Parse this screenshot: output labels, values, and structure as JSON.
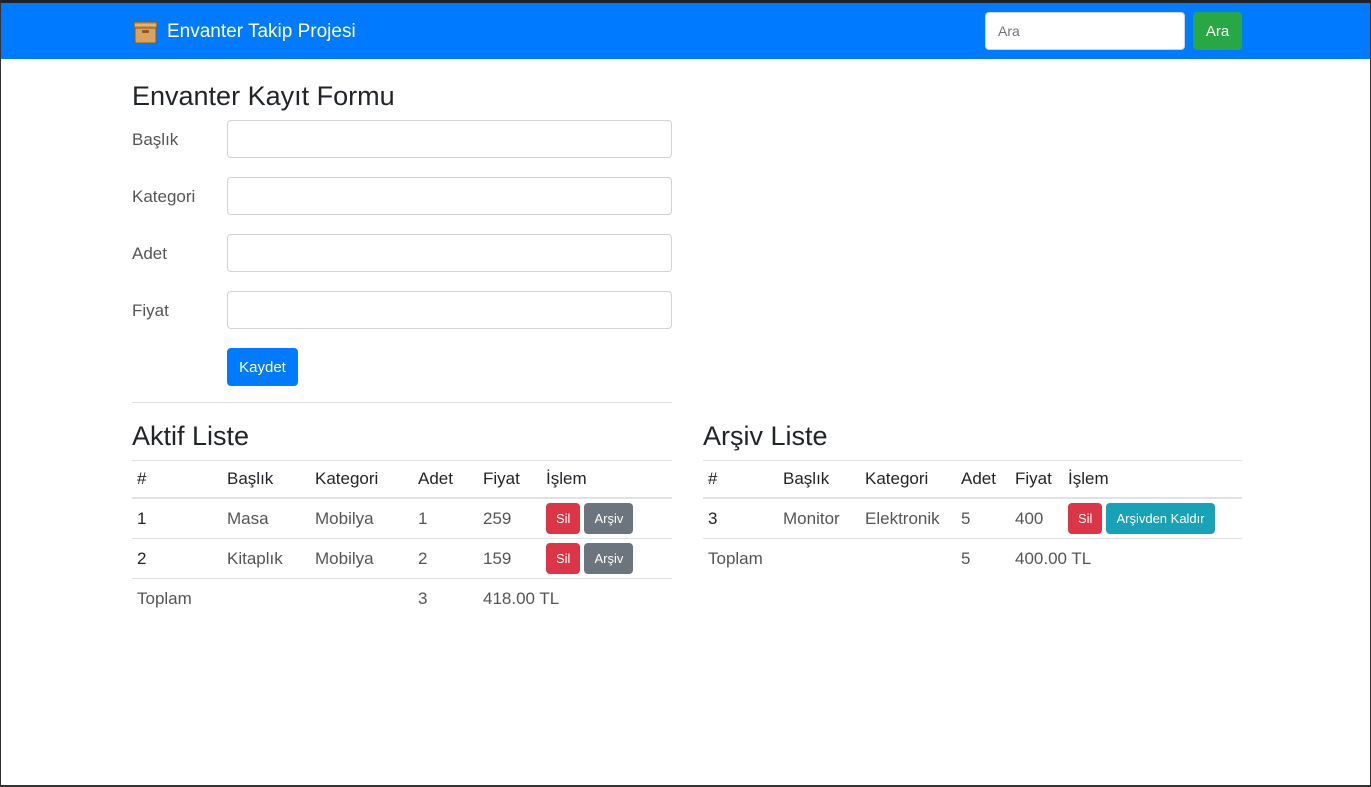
{
  "navbar": {
    "brand": "Envanter Takip Projesi",
    "brand_icon": "box-icon",
    "search": {
      "placeholder": "Ara",
      "value": ""
    },
    "search_button": "Ara",
    "colors": {
      "background": "#007bff",
      "search_button": "#28a745"
    }
  },
  "form": {
    "title": "Envanter Kayıt Formu",
    "fields": [
      {
        "label": "Başlık",
        "value": ""
      },
      {
        "label": "Kategori",
        "value": ""
      },
      {
        "label": "Adet",
        "value": ""
      },
      {
        "label": "Fiyat",
        "value": ""
      }
    ],
    "submit": "Kaydet"
  },
  "active_list": {
    "title": "Aktif Liste",
    "columns": [
      "#",
      "Başlık",
      "Kategori",
      "Adet",
      "Fiyat",
      "İşlem"
    ],
    "rows": [
      {
        "id": "1",
        "title": "Masa",
        "category": "Mobilya",
        "qty": "1",
        "price": "259",
        "delete": "Sil",
        "archive": "Arşiv"
      },
      {
        "id": "2",
        "title": "Kitaplık",
        "category": "Mobilya",
        "qty": "2",
        "price": "159",
        "delete": "Sil",
        "archive": "Arşiv"
      }
    ],
    "total": {
      "label": "Toplam",
      "qty": "3",
      "price": "418.00 TL"
    }
  },
  "archive_list": {
    "title": "Arşiv Liste",
    "columns": [
      "#",
      "Başlık",
      "Kategori",
      "Adet",
      "Fiyat",
      "İşlem"
    ],
    "rows": [
      {
        "id": "3",
        "title": "Monitor",
        "category": "Elektronik",
        "qty": "5",
        "price": "400",
        "delete": "Sil",
        "unarchive": "Arşivden Kaldır"
      }
    ],
    "total": {
      "label": "Toplam",
      "qty": "5",
      "price": "400.00 TL"
    }
  },
  "colors": {
    "danger": "#dc3545",
    "secondary": "#6c757d",
    "info": "#17a2b8",
    "primary": "#007bff"
  }
}
